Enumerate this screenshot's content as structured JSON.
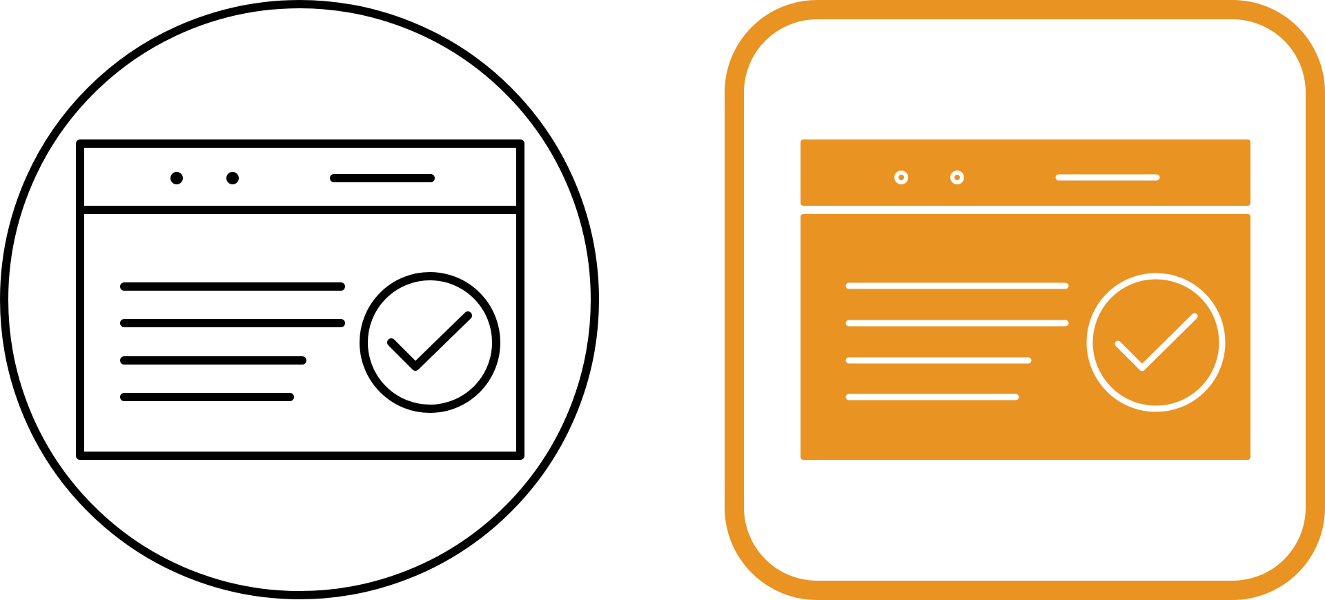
{
  "icons": [
    {
      "name": "web-page-approved-outline-icon",
      "style": "outline",
      "frame_shape": "circle",
      "stroke_color": "#000000",
      "background": "#ffffff"
    },
    {
      "name": "web-page-approved-filled-icon",
      "style": "filled",
      "frame_shape": "rounded-square",
      "accent_color": "#E99323",
      "detail_color": "#ffffff",
      "background": "#ffffff"
    }
  ]
}
